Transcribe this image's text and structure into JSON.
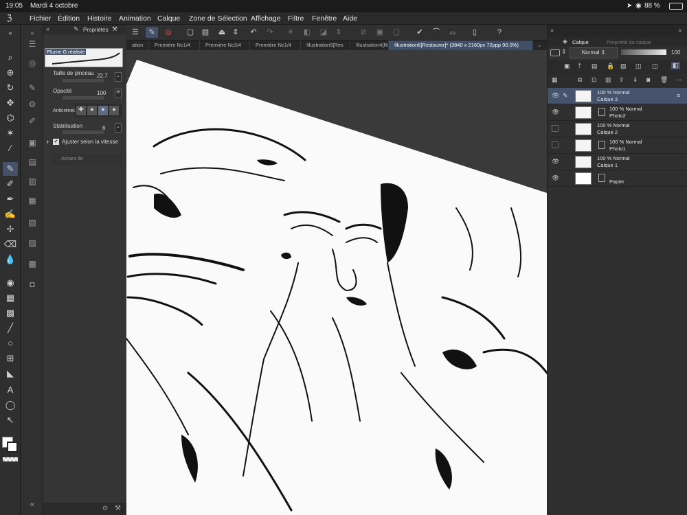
{
  "status": {
    "time": "19:05",
    "date": "Mardi 4 octobre",
    "battery": "88 %"
  },
  "menu": [
    "Fichier",
    "Édition",
    "Histoire",
    "Animation",
    "Calque",
    "Zone de Sélection",
    "Affichage",
    "Filtre",
    "Fenêtre",
    "Aide"
  ],
  "tabs": [
    "ation",
    "Première Nc1/4",
    "Première Nc3/4",
    "Première Nc1/4",
    "Illustration5[Res",
    "Illustration4[Res",
    "Illustration6[Restaurer]* (3840 x 2160px 72ppp 90.0%)"
  ],
  "props": {
    "panel_title": "Propriétés",
    "brush_name": "Plume G réaliste",
    "size_label": "Taille de pinceau",
    "size_value": "22.7",
    "opacity_label": "Opacité",
    "opacity_value": "100",
    "aa_label": "Anticrénela",
    "stab_label": "Stabilisation",
    "stab_value": "6",
    "speed_label": "Ajuster selon la vitesse",
    "magnet_label": "Aimant de"
  },
  "right_panel": {
    "tab_layer": "Calque",
    "tab_layer_props": "Propriété du calque",
    "blend_mode": "Normal",
    "opacity": "100"
  },
  "layers": [
    {
      "opacity": "100 %",
      "mode": "Normal",
      "name": "Calque 3",
      "selected": true,
      "visible": true
    },
    {
      "opacity": "100 %",
      "mode": "Normal",
      "name": "Photo2",
      "selected": false,
      "visible": true
    },
    {
      "opacity": "100 %",
      "mode": "Normal",
      "name": "Calque 2",
      "selected": false,
      "visible": false
    },
    {
      "opacity": "100 %",
      "mode": "Normal",
      "name": "Photo1",
      "selected": false,
      "visible": false
    },
    {
      "opacity": "100 %",
      "mode": "Normal",
      "name": "Calque 1",
      "selected": false,
      "visible": true
    },
    {
      "opacity": "",
      "mode": "",
      "name": "Papier",
      "selected": false,
      "visible": true
    }
  ],
  "colors": {
    "accent": "#46526a",
    "active_tab": "#3f4f66",
    "panel": "#2f2f2f"
  }
}
